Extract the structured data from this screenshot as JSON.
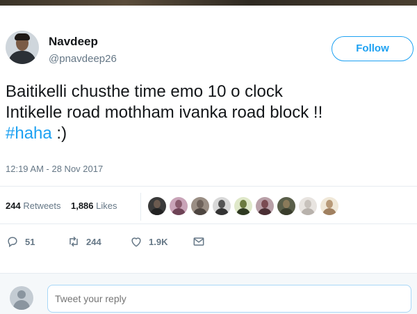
{
  "author": {
    "name": "Navdeep",
    "handle": "@pnavdeep26",
    "follow_label": "Follow"
  },
  "tweet": {
    "line1": "Baitikelli chusthe time emo 10 o clock",
    "line2": "Intikelle road mothham ivanka road block !!",
    "hashtag": "#haha",
    "line3_suffix": " :)"
  },
  "timestamp": "12:19 AM - 28 Nov 2017",
  "stats": {
    "retweets_count": "244",
    "retweets_label": "Retweets",
    "likes_count": "1,886",
    "likes_label": "Likes"
  },
  "likers": [
    {
      "icon": "liker-avatar",
      "bg": "#3a3a3a",
      "face": "#6b5a4f",
      "shirt": "#222222"
    },
    {
      "icon": "liker-avatar",
      "bg": "#c9a4b8",
      "face": "#8a5c6e",
      "shirt": "#6e4356"
    },
    {
      "icon": "liker-avatar",
      "bg": "#9a8e84",
      "face": "#6e625a",
      "shirt": "#4d4540"
    },
    {
      "icon": "liker-avatar",
      "bg": "#d8d8d8",
      "face": "#555555",
      "shirt": "#333333"
    },
    {
      "icon": "liker-avatar",
      "bg": "#dfe8c9",
      "face": "#6b7a3f",
      "shirt": "#2f3a22"
    },
    {
      "icon": "liker-avatar",
      "bg": "#b9a0a8",
      "face": "#7a4b52",
      "shirt": "#4a2f34"
    },
    {
      "icon": "liker-avatar",
      "bg": "#5a5f4a",
      "face": "#8a7a5a",
      "shirt": "#3a3d2c"
    },
    {
      "icon": "liker-avatar",
      "bg": "#e8e4e0",
      "face": "#c8c2bc",
      "shirt": "#b8b2ac"
    },
    {
      "icon": "liker-avatar",
      "bg": "#f0e8d8",
      "face": "#b89a78",
      "shirt": "#a08060"
    }
  ],
  "actions": {
    "reply_count": "51",
    "retweet_count": "244",
    "like_count": "1.9K"
  },
  "reply": {
    "placeholder": "Tweet your reply"
  },
  "colors": {
    "accent": "#1da1f2",
    "muted": "#657786",
    "text": "#14171a"
  }
}
